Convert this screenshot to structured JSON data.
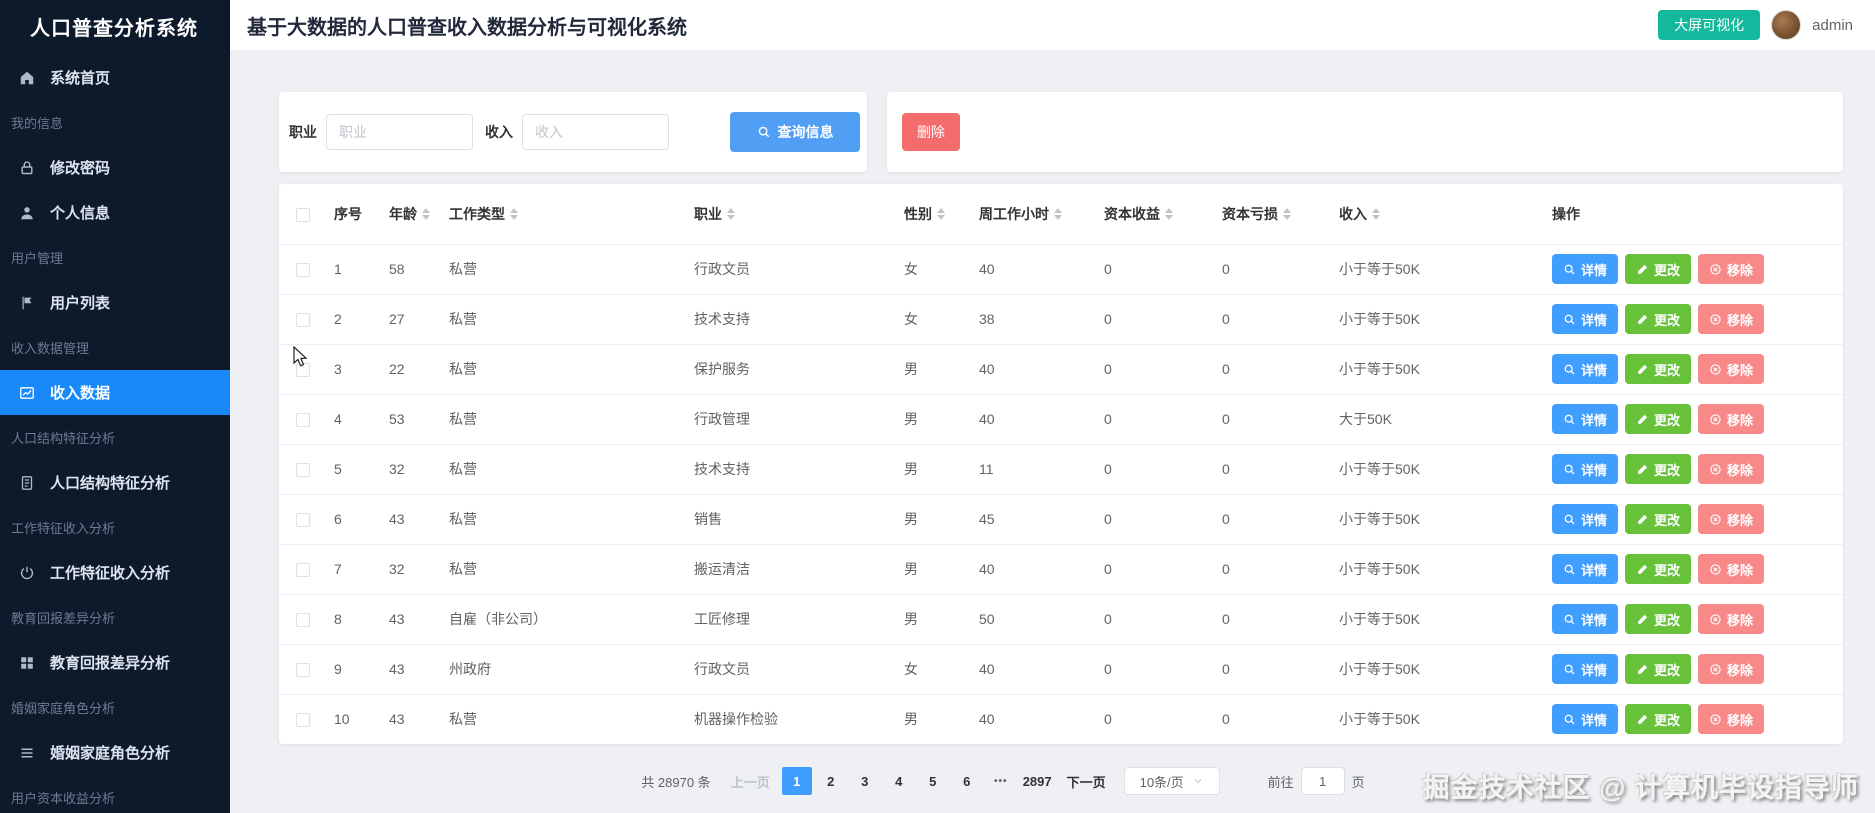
{
  "sidebar": {
    "title": "人口普查分析系统",
    "items": [
      {
        "type": "item",
        "icon": "home-icon",
        "label": "系统首页",
        "active": false
      },
      {
        "type": "section",
        "label": "我的信息"
      },
      {
        "type": "item",
        "icon": "lock-icon",
        "label": "修改密码",
        "active": false
      },
      {
        "type": "item",
        "icon": "user-icon",
        "label": "个人信息",
        "active": false
      },
      {
        "type": "section",
        "label": "用户管理"
      },
      {
        "type": "item",
        "icon": "flag-icon",
        "label": "用户列表",
        "active": false
      },
      {
        "type": "section",
        "label": "收入数据管理"
      },
      {
        "type": "item",
        "icon": "trend-chart-icon",
        "label": "收入数据",
        "active": true
      },
      {
        "type": "section",
        "label": "人口结构特征分析"
      },
      {
        "type": "item",
        "icon": "document-icon",
        "label": "人口结构特征分析",
        "active": false
      },
      {
        "type": "section",
        "label": "工作特征收入分析"
      },
      {
        "type": "item",
        "icon": "power-icon",
        "label": "工作特征收入分析",
        "active": false
      },
      {
        "type": "section",
        "label": "教育回报差异分析"
      },
      {
        "type": "item",
        "icon": "grid-icon",
        "label": "教育回报差异分析",
        "active": false
      },
      {
        "type": "section",
        "label": "婚姻家庭角色分析"
      },
      {
        "type": "item",
        "icon": "menu-list-icon",
        "label": "婚姻家庭角色分析",
        "active": false
      },
      {
        "type": "section",
        "label": "用户资本收益分析"
      }
    ]
  },
  "header": {
    "title": "基于大数据的人口普查收入数据分析与可视化系统",
    "screen_button": "大屏可视化",
    "username": "admin"
  },
  "search": {
    "occupation_label": "职业",
    "occupation_placeholder": "职业",
    "income_label": "收入",
    "income_placeholder": "收入",
    "query_button": "查询信息",
    "delete_button": "删除"
  },
  "table": {
    "columns": [
      {
        "label": "序号",
        "sortable": false
      },
      {
        "label": "年龄",
        "sortable": true
      },
      {
        "label": "工作类型",
        "sortable": true
      },
      {
        "label": "职业",
        "sortable": true
      },
      {
        "label": "性别",
        "sortable": true
      },
      {
        "label": "周工作小时",
        "sortable": true
      },
      {
        "label": "资本收益",
        "sortable": true
      },
      {
        "label": "资本亏损",
        "sortable": true
      },
      {
        "label": "收入",
        "sortable": true
      },
      {
        "label": "操作",
        "sortable": false
      }
    ],
    "rows": [
      {
        "index": "1",
        "age": "58",
        "work_type": "私营",
        "occupation": "行政文员",
        "gender": "女",
        "hours": "40",
        "capital_gain": "0",
        "capital_loss": "0",
        "income": "小于等于50K"
      },
      {
        "index": "2",
        "age": "27",
        "work_type": "私营",
        "occupation": "技术支持",
        "gender": "女",
        "hours": "38",
        "capital_gain": "0",
        "capital_loss": "0",
        "income": "小于等于50K"
      },
      {
        "index": "3",
        "age": "22",
        "work_type": "私营",
        "occupation": "保护服务",
        "gender": "男",
        "hours": "40",
        "capital_gain": "0",
        "capital_loss": "0",
        "income": "小于等于50K"
      },
      {
        "index": "4",
        "age": "53",
        "work_type": "私营",
        "occupation": "行政管理",
        "gender": "男",
        "hours": "40",
        "capital_gain": "0",
        "capital_loss": "0",
        "income": "大于50K"
      },
      {
        "index": "5",
        "age": "32",
        "work_type": "私营",
        "occupation": "技术支持",
        "gender": "男",
        "hours": "11",
        "capital_gain": "0",
        "capital_loss": "0",
        "income": "小于等于50K"
      },
      {
        "index": "6",
        "age": "43",
        "work_type": "私营",
        "occupation": "销售",
        "gender": "男",
        "hours": "45",
        "capital_gain": "0",
        "capital_loss": "0",
        "income": "小于等于50K"
      },
      {
        "index": "7",
        "age": "32",
        "work_type": "私营",
        "occupation": "搬运清洁",
        "gender": "男",
        "hours": "40",
        "capital_gain": "0",
        "capital_loss": "0",
        "income": "小于等于50K"
      },
      {
        "index": "8",
        "age": "43",
        "work_type": "自雇（非公司）",
        "occupation": "工匠修理",
        "gender": "男",
        "hours": "50",
        "capital_gain": "0",
        "capital_loss": "0",
        "income": "小于等于50K"
      },
      {
        "index": "9",
        "age": "43",
        "work_type": "州政府",
        "occupation": "行政文员",
        "gender": "女",
        "hours": "40",
        "capital_gain": "0",
        "capital_loss": "0",
        "income": "小于等于50K"
      },
      {
        "index": "10",
        "age": "43",
        "work_type": "私营",
        "occupation": "机器操作检验",
        "gender": "男",
        "hours": "40",
        "capital_gain": "0",
        "capital_loss": "0",
        "income": "小于等于50K"
      }
    ],
    "actions": [
      {
        "kind": "detail",
        "label": "详情",
        "icon": "search-icon"
      },
      {
        "kind": "edit",
        "label": "更改",
        "icon": "pencil-icon"
      },
      {
        "kind": "remove",
        "label": "移除",
        "icon": "remove-icon"
      }
    ]
  },
  "pagination": {
    "total_text": "共 28970 条",
    "prev": "上一页",
    "pages": [
      "1",
      "2",
      "3",
      "4",
      "5",
      "6",
      "•••",
      "2897"
    ],
    "active_page": "1",
    "next": "下一页",
    "page_size": "10条/页",
    "goto_label": "前往",
    "goto_value": "1",
    "goto_suffix": "页"
  },
  "watermark": "掘金技术社区 @ 计算机毕设指导师",
  "colors": {
    "sidebar_bg": "#0d1a2b",
    "active_menu_blue": "#1989fa",
    "primary_blue": "#409eff",
    "query_blue": "#519ef5",
    "success_green": "#67c23a",
    "danger_red": "#f56c6c",
    "remove_salmon": "#f78989",
    "screen_teal": "#14b89c"
  }
}
